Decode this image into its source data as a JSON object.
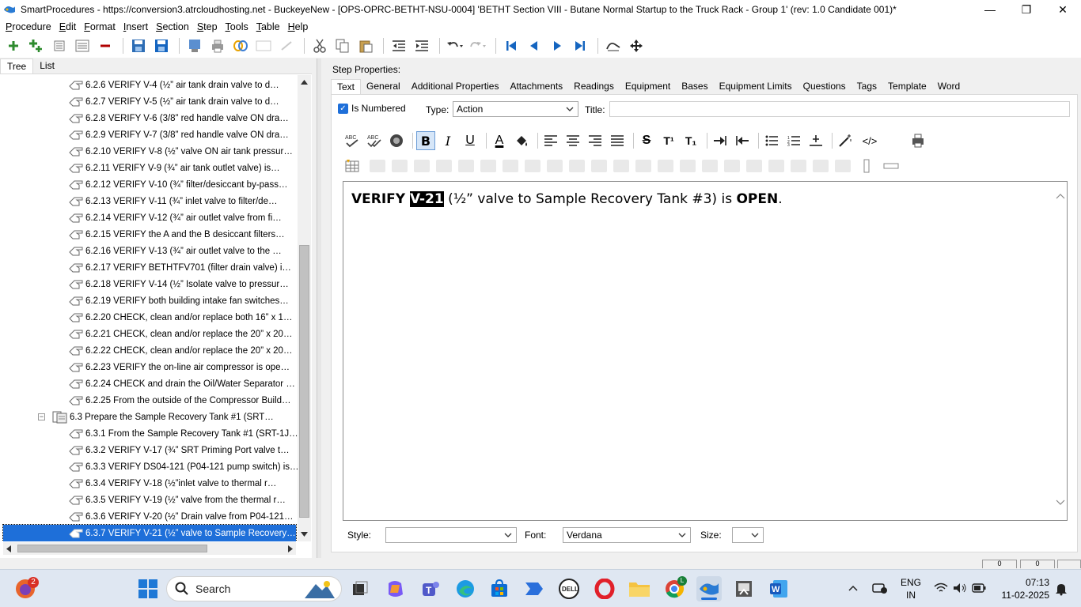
{
  "window": {
    "title": "SmartProcedures - https://conversion3.atrcloudhosting.net - BuckeyeNew - [OPS-OPRC-BETHT-NSU-0004] 'BETHT Section VIII - Butane Normal Startup to the Truck Rack - Group 1' (rev: 1.0 Candidate 001)*",
    "minimize": "—",
    "restore": "❐",
    "close": "✕"
  },
  "menu": [
    "Procedure",
    "Edit",
    "Format",
    "Insert",
    "Section",
    "Step",
    "Tools",
    "Table",
    "Help"
  ],
  "left_tabs": [
    "Tree",
    "List"
  ],
  "tree": [
    {
      "label": "6.2.6 VERIFY V-4 (½” air tank drain valve to d…",
      "level": 2
    },
    {
      "label": "6.2.7 VERIFY V-5 (½” air tank drain valve to d…",
      "level": 2
    },
    {
      "label": "6.2.8 VERIFY V-6 (3/8” red handle valve ON dra…",
      "level": 2
    },
    {
      "label": "6.2.9 VERIFY V-7 (3/8” red handle valve ON dra…",
      "level": 2
    },
    {
      "label": "6.2.10 VERIFY V-8 (½” valve ON air tank pressur…",
      "level": 2
    },
    {
      "label": "6.2.11 VERIFY V-9 (¾” air tank outlet valve) is…",
      "level": 2
    },
    {
      "label": "6.2.12 VERIFY V-10 (¾” filter/desiccant by-pass…",
      "level": 2
    },
    {
      "label": "6.2.13 VERIFY V-11 (¾” inlet valve to filter/de…",
      "level": 2
    },
    {
      "label": "6.2.14 VERIFY V-12 (¾” air outlet valve from fi…",
      "level": 2
    },
    {
      "label": "6.2.15 VERIFY the A and the B desiccant filters…",
      "level": 2
    },
    {
      "label": "6.2.16 VERIFY V-13 (¾” air outlet valve to the …",
      "level": 2
    },
    {
      "label": "6.2.17 VERIFY BETHTFV701 (filter drain valve) i…",
      "level": 2
    },
    {
      "label": "6.2.18 VERIFY V-14 (½” Isolate valve to pressur…",
      "level": 2
    },
    {
      "label": "6.2.19 VERIFY both building intake fan switches…",
      "level": 2
    },
    {
      "label": "6.2.20 CHECK, clean and/or replace both 16” x 1…",
      "level": 2
    },
    {
      "label": "6.2.21 CHECK, clean and/or replace the 20” x 20…",
      "level": 2
    },
    {
      "label": "6.2.22 CHECK, clean and/or replace the 20” x 20…",
      "level": 2
    },
    {
      "label": "6.2.23 VERIFY the on-line air compressor is ope…",
      "level": 2
    },
    {
      "label": "6.2.24 CHECK and drain the Oil/Water Separator …",
      "level": 2
    },
    {
      "label": "6.2.25 From the outside of the Compressor Build…",
      "level": 2
    },
    {
      "label": "6.3 Prepare the Sample Recovery Tank #1 (SRT…",
      "level": 1
    },
    {
      "label": "6.3.1 From the Sample Recovery Tank #1 (SRT-1J…",
      "level": 2
    },
    {
      "label": "6.3.2 VERIFY V-17 (¾” SRT Priming Port valve t…",
      "level": 2
    },
    {
      "label": "6.3.3 VERIFY DS04-121 (P04-121 pump switch) is…",
      "level": 2
    },
    {
      "label": "6.3.4 VERIFY V-18 (½”inlet valve to thermal r…",
      "level": 2
    },
    {
      "label": "6.3.5 VERIFY V-19 (½” valve from the thermal r…",
      "level": 2
    },
    {
      "label": "6.3.6 VERIFY V-20 (½” Drain valve from P04-121…",
      "level": 2
    },
    {
      "label": "6.3.7 VERIFY V-21 (½” valve to Sample Recovery…",
      "level": 2
    }
  ],
  "collapse_symbol": "−",
  "right": {
    "step_properties": "Step Properties:",
    "tabs": [
      "Text",
      "General",
      "Additional Properties",
      "Attachments",
      "Readings",
      "Equipment",
      "Bases",
      "Equipment Limits",
      "Questions",
      "Tags",
      "Template",
      "Word"
    ],
    "is_numbered_label": "Is Numbered",
    "is_numbered_check": "✓",
    "type_label": "Type:",
    "type_value": "Action",
    "title_label": "Title:",
    "title_value": "",
    "editor": {
      "part1": "VERIFY ",
      "highlight": "V-21",
      "part2": " (½” valve to Sample Recovery Tank #3) is ",
      "part3": "OPEN",
      "part4": "."
    },
    "style_label": "Style:",
    "style_value": "",
    "font_label": "Font:",
    "font_value": "Verdana",
    "size_label": "Size:",
    "size_value": ""
  },
  "format_glyphs": {
    "bold": "B",
    "italic": "I",
    "underline": "U",
    "font_color": "A",
    "strike": "S",
    "superscript": "T¹",
    "subscript": "T₁",
    "code": "</>"
  },
  "status": {
    "cell1": "0",
    "cell2": "0"
  },
  "taskbar": {
    "search_placeholder": "Search",
    "badge": "2",
    "lang_line1": "ENG",
    "lang_line2": "IN",
    "time": "07:13",
    "date": "11-02-2025",
    "chrome_badge": "L"
  },
  "colors": {
    "selection": "#1e6fd9",
    "toolbar_blue": "#1565c0",
    "green_add": "#2e8b2e"
  }
}
